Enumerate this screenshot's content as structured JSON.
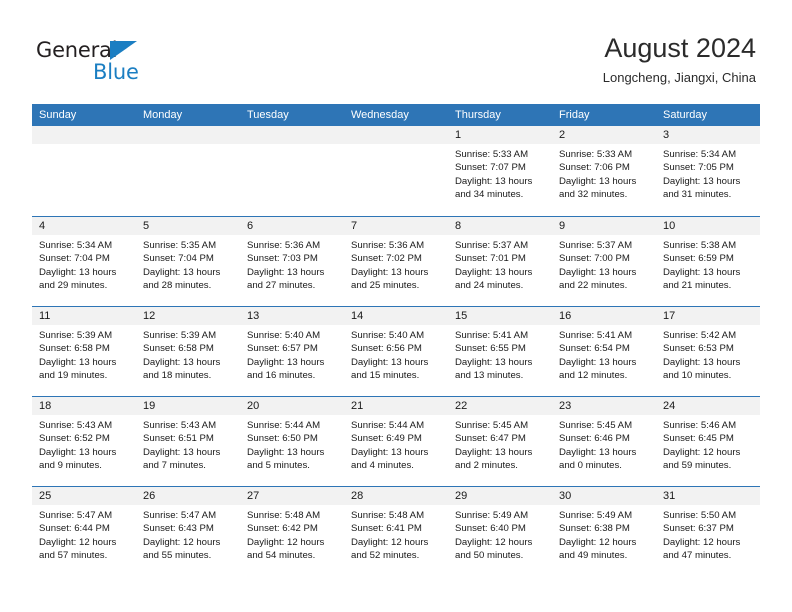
{
  "brand": {
    "name_part1": "General",
    "name_part2": "Blue",
    "accent_color": "#1b7ec2"
  },
  "header": {
    "title": "August 2024",
    "subtitle": "Longcheng, Jiangxi, China"
  },
  "theme": {
    "header_blue": "#2e75b6",
    "day_number_band": "#f2f2f2",
    "text": "#1a1a1a"
  },
  "weekdays": [
    "Sunday",
    "Monday",
    "Tuesday",
    "Wednesday",
    "Thursday",
    "Friday",
    "Saturday"
  ],
  "weeks": [
    [
      {
        "day": "",
        "empty": true
      },
      {
        "day": "",
        "empty": true
      },
      {
        "day": "",
        "empty": true
      },
      {
        "day": "",
        "empty": true
      },
      {
        "day": "1",
        "sunrise": "Sunrise: 5:33 AM",
        "sunset": "Sunset: 7:07 PM",
        "daylight": "Daylight: 13 hours and 34 minutes."
      },
      {
        "day": "2",
        "sunrise": "Sunrise: 5:33 AM",
        "sunset": "Sunset: 7:06 PM",
        "daylight": "Daylight: 13 hours and 32 minutes."
      },
      {
        "day": "3",
        "sunrise": "Sunrise: 5:34 AM",
        "sunset": "Sunset: 7:05 PM",
        "daylight": "Daylight: 13 hours and 31 minutes."
      }
    ],
    [
      {
        "day": "4",
        "sunrise": "Sunrise: 5:34 AM",
        "sunset": "Sunset: 7:04 PM",
        "daylight": "Daylight: 13 hours and 29 minutes."
      },
      {
        "day": "5",
        "sunrise": "Sunrise: 5:35 AM",
        "sunset": "Sunset: 7:04 PM",
        "daylight": "Daylight: 13 hours and 28 minutes."
      },
      {
        "day": "6",
        "sunrise": "Sunrise: 5:36 AM",
        "sunset": "Sunset: 7:03 PM",
        "daylight": "Daylight: 13 hours and 27 minutes."
      },
      {
        "day": "7",
        "sunrise": "Sunrise: 5:36 AM",
        "sunset": "Sunset: 7:02 PM",
        "daylight": "Daylight: 13 hours and 25 minutes."
      },
      {
        "day": "8",
        "sunrise": "Sunrise: 5:37 AM",
        "sunset": "Sunset: 7:01 PM",
        "daylight": "Daylight: 13 hours and 24 minutes."
      },
      {
        "day": "9",
        "sunrise": "Sunrise: 5:37 AM",
        "sunset": "Sunset: 7:00 PM",
        "daylight": "Daylight: 13 hours and 22 minutes."
      },
      {
        "day": "10",
        "sunrise": "Sunrise: 5:38 AM",
        "sunset": "Sunset: 6:59 PM",
        "daylight": "Daylight: 13 hours and 21 minutes."
      }
    ],
    [
      {
        "day": "11",
        "sunrise": "Sunrise: 5:39 AM",
        "sunset": "Sunset: 6:58 PM",
        "daylight": "Daylight: 13 hours and 19 minutes."
      },
      {
        "day": "12",
        "sunrise": "Sunrise: 5:39 AM",
        "sunset": "Sunset: 6:58 PM",
        "daylight": "Daylight: 13 hours and 18 minutes."
      },
      {
        "day": "13",
        "sunrise": "Sunrise: 5:40 AM",
        "sunset": "Sunset: 6:57 PM",
        "daylight": "Daylight: 13 hours and 16 minutes."
      },
      {
        "day": "14",
        "sunrise": "Sunrise: 5:40 AM",
        "sunset": "Sunset: 6:56 PM",
        "daylight": "Daylight: 13 hours and 15 minutes."
      },
      {
        "day": "15",
        "sunrise": "Sunrise: 5:41 AM",
        "sunset": "Sunset: 6:55 PM",
        "daylight": "Daylight: 13 hours and 13 minutes."
      },
      {
        "day": "16",
        "sunrise": "Sunrise: 5:41 AM",
        "sunset": "Sunset: 6:54 PM",
        "daylight": "Daylight: 13 hours and 12 minutes."
      },
      {
        "day": "17",
        "sunrise": "Sunrise: 5:42 AM",
        "sunset": "Sunset: 6:53 PM",
        "daylight": "Daylight: 13 hours and 10 minutes."
      }
    ],
    [
      {
        "day": "18",
        "sunrise": "Sunrise: 5:43 AM",
        "sunset": "Sunset: 6:52 PM",
        "daylight": "Daylight: 13 hours and 9 minutes."
      },
      {
        "day": "19",
        "sunrise": "Sunrise: 5:43 AM",
        "sunset": "Sunset: 6:51 PM",
        "daylight": "Daylight: 13 hours and 7 minutes."
      },
      {
        "day": "20",
        "sunrise": "Sunrise: 5:44 AM",
        "sunset": "Sunset: 6:50 PM",
        "daylight": "Daylight: 13 hours and 5 minutes."
      },
      {
        "day": "21",
        "sunrise": "Sunrise: 5:44 AM",
        "sunset": "Sunset: 6:49 PM",
        "daylight": "Daylight: 13 hours and 4 minutes."
      },
      {
        "day": "22",
        "sunrise": "Sunrise: 5:45 AM",
        "sunset": "Sunset: 6:47 PM",
        "daylight": "Daylight: 13 hours and 2 minutes."
      },
      {
        "day": "23",
        "sunrise": "Sunrise: 5:45 AM",
        "sunset": "Sunset: 6:46 PM",
        "daylight": "Daylight: 13 hours and 0 minutes."
      },
      {
        "day": "24",
        "sunrise": "Sunrise: 5:46 AM",
        "sunset": "Sunset: 6:45 PM",
        "daylight": "Daylight: 12 hours and 59 minutes."
      }
    ],
    [
      {
        "day": "25",
        "sunrise": "Sunrise: 5:47 AM",
        "sunset": "Sunset: 6:44 PM",
        "daylight": "Daylight: 12 hours and 57 minutes."
      },
      {
        "day": "26",
        "sunrise": "Sunrise: 5:47 AM",
        "sunset": "Sunset: 6:43 PM",
        "daylight": "Daylight: 12 hours and 55 minutes."
      },
      {
        "day": "27",
        "sunrise": "Sunrise: 5:48 AM",
        "sunset": "Sunset: 6:42 PM",
        "daylight": "Daylight: 12 hours and 54 minutes."
      },
      {
        "day": "28",
        "sunrise": "Sunrise: 5:48 AM",
        "sunset": "Sunset: 6:41 PM",
        "daylight": "Daylight: 12 hours and 52 minutes."
      },
      {
        "day": "29",
        "sunrise": "Sunrise: 5:49 AM",
        "sunset": "Sunset: 6:40 PM",
        "daylight": "Daylight: 12 hours and 50 minutes."
      },
      {
        "day": "30",
        "sunrise": "Sunrise: 5:49 AM",
        "sunset": "Sunset: 6:38 PM",
        "daylight": "Daylight: 12 hours and 49 minutes."
      },
      {
        "day": "31",
        "sunrise": "Sunrise: 5:50 AM",
        "sunset": "Sunset: 6:37 PM",
        "daylight": "Daylight: 12 hours and 47 minutes."
      }
    ]
  ]
}
